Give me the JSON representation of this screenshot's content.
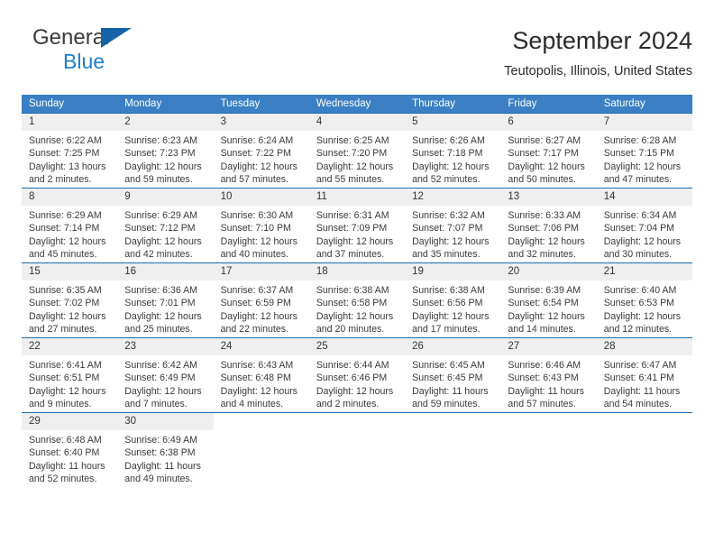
{
  "brand": {
    "line1": "General",
    "line2": "Blue",
    "triangle_color": "#1463a8",
    "blue_color": "#1f7fd0"
  },
  "header": {
    "title": "September 2024",
    "subtitle": "Teutopolis, Illinois, United States"
  },
  "theme": {
    "header_bg": "#3b7fc4",
    "week_border": "#1f6bb0",
    "daynum_bg": "#efefef"
  },
  "weekday_headers": [
    "Sunday",
    "Monday",
    "Tuesday",
    "Wednesday",
    "Thursday",
    "Friday",
    "Saturday"
  ],
  "weeks": [
    [
      {
        "day": "1",
        "sunrise": "Sunrise: 6:22 AM",
        "sunset": "Sunset: 7:25 PM",
        "daylight1": "Daylight: 13 hours",
        "daylight2": "and 2 minutes."
      },
      {
        "day": "2",
        "sunrise": "Sunrise: 6:23 AM",
        "sunset": "Sunset: 7:23 PM",
        "daylight1": "Daylight: 12 hours",
        "daylight2": "and 59 minutes."
      },
      {
        "day": "3",
        "sunrise": "Sunrise: 6:24 AM",
        "sunset": "Sunset: 7:22 PM",
        "daylight1": "Daylight: 12 hours",
        "daylight2": "and 57 minutes."
      },
      {
        "day": "4",
        "sunrise": "Sunrise: 6:25 AM",
        "sunset": "Sunset: 7:20 PM",
        "daylight1": "Daylight: 12 hours",
        "daylight2": "and 55 minutes."
      },
      {
        "day": "5",
        "sunrise": "Sunrise: 6:26 AM",
        "sunset": "Sunset: 7:18 PM",
        "daylight1": "Daylight: 12 hours",
        "daylight2": "and 52 minutes."
      },
      {
        "day": "6",
        "sunrise": "Sunrise: 6:27 AM",
        "sunset": "Sunset: 7:17 PM",
        "daylight1": "Daylight: 12 hours",
        "daylight2": "and 50 minutes."
      },
      {
        "day": "7",
        "sunrise": "Sunrise: 6:28 AM",
        "sunset": "Sunset: 7:15 PM",
        "daylight1": "Daylight: 12 hours",
        "daylight2": "and 47 minutes."
      }
    ],
    [
      {
        "day": "8",
        "sunrise": "Sunrise: 6:29 AM",
        "sunset": "Sunset: 7:14 PM",
        "daylight1": "Daylight: 12 hours",
        "daylight2": "and 45 minutes."
      },
      {
        "day": "9",
        "sunrise": "Sunrise: 6:29 AM",
        "sunset": "Sunset: 7:12 PM",
        "daylight1": "Daylight: 12 hours",
        "daylight2": "and 42 minutes."
      },
      {
        "day": "10",
        "sunrise": "Sunrise: 6:30 AM",
        "sunset": "Sunset: 7:10 PM",
        "daylight1": "Daylight: 12 hours",
        "daylight2": "and 40 minutes."
      },
      {
        "day": "11",
        "sunrise": "Sunrise: 6:31 AM",
        "sunset": "Sunset: 7:09 PM",
        "daylight1": "Daylight: 12 hours",
        "daylight2": "and 37 minutes."
      },
      {
        "day": "12",
        "sunrise": "Sunrise: 6:32 AM",
        "sunset": "Sunset: 7:07 PM",
        "daylight1": "Daylight: 12 hours",
        "daylight2": "and 35 minutes."
      },
      {
        "day": "13",
        "sunrise": "Sunrise: 6:33 AM",
        "sunset": "Sunset: 7:06 PM",
        "daylight1": "Daylight: 12 hours",
        "daylight2": "and 32 minutes."
      },
      {
        "day": "14",
        "sunrise": "Sunrise: 6:34 AM",
        "sunset": "Sunset: 7:04 PM",
        "daylight1": "Daylight: 12 hours",
        "daylight2": "and 30 minutes."
      }
    ],
    [
      {
        "day": "15",
        "sunrise": "Sunrise: 6:35 AM",
        "sunset": "Sunset: 7:02 PM",
        "daylight1": "Daylight: 12 hours",
        "daylight2": "and 27 minutes."
      },
      {
        "day": "16",
        "sunrise": "Sunrise: 6:36 AM",
        "sunset": "Sunset: 7:01 PM",
        "daylight1": "Daylight: 12 hours",
        "daylight2": "and 25 minutes."
      },
      {
        "day": "17",
        "sunrise": "Sunrise: 6:37 AM",
        "sunset": "Sunset: 6:59 PM",
        "daylight1": "Daylight: 12 hours",
        "daylight2": "and 22 minutes."
      },
      {
        "day": "18",
        "sunrise": "Sunrise: 6:38 AM",
        "sunset": "Sunset: 6:58 PM",
        "daylight1": "Daylight: 12 hours",
        "daylight2": "and 20 minutes."
      },
      {
        "day": "19",
        "sunrise": "Sunrise: 6:38 AM",
        "sunset": "Sunset: 6:56 PM",
        "daylight1": "Daylight: 12 hours",
        "daylight2": "and 17 minutes."
      },
      {
        "day": "20",
        "sunrise": "Sunrise: 6:39 AM",
        "sunset": "Sunset: 6:54 PM",
        "daylight1": "Daylight: 12 hours",
        "daylight2": "and 14 minutes."
      },
      {
        "day": "21",
        "sunrise": "Sunrise: 6:40 AM",
        "sunset": "Sunset: 6:53 PM",
        "daylight1": "Daylight: 12 hours",
        "daylight2": "and 12 minutes."
      }
    ],
    [
      {
        "day": "22",
        "sunrise": "Sunrise: 6:41 AM",
        "sunset": "Sunset: 6:51 PM",
        "daylight1": "Daylight: 12 hours",
        "daylight2": "and 9 minutes."
      },
      {
        "day": "23",
        "sunrise": "Sunrise: 6:42 AM",
        "sunset": "Sunset: 6:49 PM",
        "daylight1": "Daylight: 12 hours",
        "daylight2": "and 7 minutes."
      },
      {
        "day": "24",
        "sunrise": "Sunrise: 6:43 AM",
        "sunset": "Sunset: 6:48 PM",
        "daylight1": "Daylight: 12 hours",
        "daylight2": "and 4 minutes."
      },
      {
        "day": "25",
        "sunrise": "Sunrise: 6:44 AM",
        "sunset": "Sunset: 6:46 PM",
        "daylight1": "Daylight: 12 hours",
        "daylight2": "and 2 minutes."
      },
      {
        "day": "26",
        "sunrise": "Sunrise: 6:45 AM",
        "sunset": "Sunset: 6:45 PM",
        "daylight1": "Daylight: 11 hours",
        "daylight2": "and 59 minutes."
      },
      {
        "day": "27",
        "sunrise": "Sunrise: 6:46 AM",
        "sunset": "Sunset: 6:43 PM",
        "daylight1": "Daylight: 11 hours",
        "daylight2": "and 57 minutes."
      },
      {
        "day": "28",
        "sunrise": "Sunrise: 6:47 AM",
        "sunset": "Sunset: 6:41 PM",
        "daylight1": "Daylight: 11 hours",
        "daylight2": "and 54 minutes."
      }
    ],
    [
      {
        "day": "29",
        "sunrise": "Sunrise: 6:48 AM",
        "sunset": "Sunset: 6:40 PM",
        "daylight1": "Daylight: 11 hours",
        "daylight2": "and 52 minutes."
      },
      {
        "day": "30",
        "sunrise": "Sunrise: 6:49 AM",
        "sunset": "Sunset: 6:38 PM",
        "daylight1": "Daylight: 11 hours",
        "daylight2": "and 49 minutes."
      },
      {
        "day": "",
        "sunrise": "",
        "sunset": "",
        "daylight1": "",
        "daylight2": ""
      },
      {
        "day": "",
        "sunrise": "",
        "sunset": "",
        "daylight1": "",
        "daylight2": ""
      },
      {
        "day": "",
        "sunrise": "",
        "sunset": "",
        "daylight1": "",
        "daylight2": ""
      },
      {
        "day": "",
        "sunrise": "",
        "sunset": "",
        "daylight1": "",
        "daylight2": ""
      },
      {
        "day": "",
        "sunrise": "",
        "sunset": "",
        "daylight1": "",
        "daylight2": ""
      }
    ]
  ]
}
